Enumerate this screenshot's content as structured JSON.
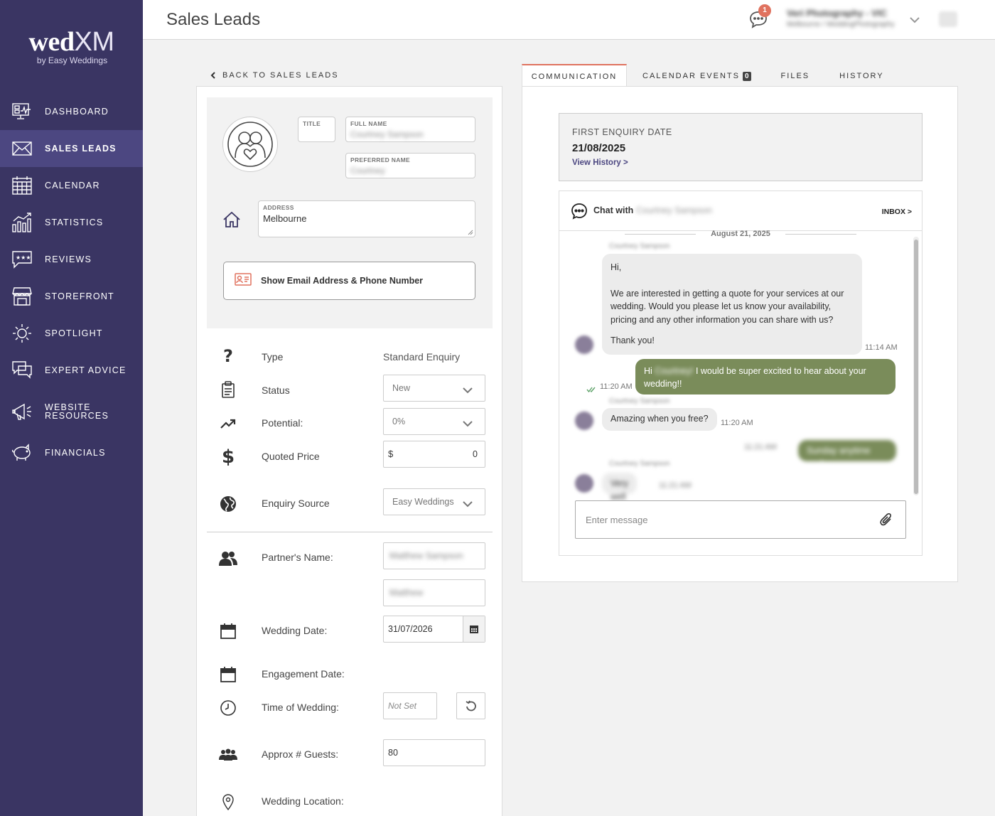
{
  "app": {
    "logo_main_bold": "wed",
    "logo_main_light": "XM",
    "logo_sub": "by Easy Weddings"
  },
  "sidebar": {
    "items": [
      {
        "label": "DASHBOARD",
        "icon": "dashboard-icon"
      },
      {
        "label": "SALES LEADS",
        "icon": "envelope-icon",
        "active": true
      },
      {
        "label": "CALENDAR",
        "icon": "calendar-icon"
      },
      {
        "label": "STATISTICS",
        "icon": "bar-chart-icon"
      },
      {
        "label": "REVIEWS",
        "icon": "reviews-icon"
      },
      {
        "label": "STOREFRONT",
        "icon": "storefront-icon"
      },
      {
        "label": "SPOTLIGHT",
        "icon": "sun-icon"
      },
      {
        "label": "EXPERT ADVICE",
        "icon": "speech-bubbles-icon"
      },
      {
        "label_line1": "WEBSITE",
        "label_line2": "RESOURCES",
        "icon": "megaphone-icon"
      },
      {
        "label": "FINANCIALS",
        "icon": "piggy-bank-icon"
      }
    ]
  },
  "header": {
    "title": "Sales Leads",
    "notification_count": "1",
    "account_name": "Veri Photography - VIC",
    "account_sub": "Melbourne / WeddingPhotography"
  },
  "back_link": "BACK TO SALES LEADS",
  "profile": {
    "title_label": "TITLE",
    "title_value": "",
    "full_name_label": "FULL NAME",
    "full_name_value": "Courtney Sampson",
    "preferred_name_label": "PREFERRED NAME",
    "preferred_name_value": "Courtney",
    "address_label": "ADDRESS",
    "address_value": "Melbourne",
    "show_contact_button": "Show Email Address & Phone Number"
  },
  "details": {
    "type_label": "Type",
    "type_value": "Standard Enquiry",
    "status_label": "Status",
    "status_value": "New",
    "potential_label": "Potential:",
    "potential_value": "0%",
    "quoted_price_label": "Quoted Price",
    "quoted_price_currency": "$",
    "quoted_price_value": "0",
    "enquiry_source_label": "Enquiry Source",
    "enquiry_source_value": "Easy Weddings",
    "partner_name_label": "Partner's Name:",
    "partner_full_name": "Matthew Sampson",
    "partner_short_name": "Matthew",
    "wedding_date_label": "Wedding Date:",
    "wedding_date_value": "31/07/2026",
    "engagement_date_label": "Engagement Date:",
    "time_of_wedding_label": "Time of Wedding:",
    "time_of_wedding_placeholder": "Not Set",
    "guests_label": "Approx # Guests:",
    "guests_value": "80",
    "location_label": "Wedding Location:"
  },
  "tabs": [
    {
      "label": "COMMUNICATION",
      "active": true
    },
    {
      "label": "CALENDAR EVENTS",
      "count": "0"
    },
    {
      "label": "FILES"
    },
    {
      "label": "HISTORY"
    }
  ],
  "enquiry": {
    "label": "FIRST ENQUIRY DATE",
    "date": "21/08/2025",
    "link": "View History >"
  },
  "chat": {
    "with_label": "Chat with",
    "with_name": "Courtney Sampson",
    "inbox_link": "INBOX >",
    "date_separator": "August 21, 2025",
    "messages": [
      {
        "sender": "Courtney Sampson",
        "direction": "in",
        "lines": [
          "Hi,",
          "We are interested in getting a quote for your services at our wedding. Would you please let us know your availability, pricing and any other information you can share with us?",
          "Thank you!"
        ],
        "time": "11:14 AM"
      },
      {
        "direction": "out",
        "text_before": "Hi ",
        "text_blurred": "Courtney!",
        "text_after": " I would be super excited to hear about your wedding!!",
        "time": "11:20 AM"
      },
      {
        "sender": "Courtney Sampson",
        "direction": "in",
        "text": "Amazing when you free?",
        "time": "11:20 AM"
      },
      {
        "direction": "out",
        "text": "Sunday anytime works",
        "time": "11:21 AM"
      },
      {
        "sender": "Courtney Sampson",
        "direction": "in",
        "text": "Very well",
        "time": "11:21 AM"
      }
    ],
    "input_placeholder": "Enter message"
  },
  "colors": {
    "sidebar_bg": "#3a3563",
    "sidebar_active": "#4c4781",
    "accent": "#e0725f",
    "outgoing_bubble": "#7a8c5a"
  }
}
